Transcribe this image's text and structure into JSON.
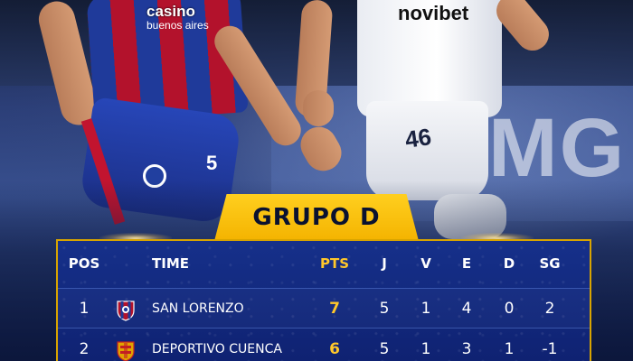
{
  "photo": {
    "left_player_sponsor_line1": "casino",
    "left_player_sponsor_line2": "buenos aires",
    "left_player_number": "5",
    "right_player_sponsor": "novibet",
    "right_player_number": "46",
    "background_board_text": "MG"
  },
  "banner": {
    "title": "GRUPO D"
  },
  "table": {
    "headers": {
      "pos": "POS",
      "team": "TIME",
      "pts": "PTS",
      "j": "J",
      "v": "V",
      "e": "E",
      "d": "D",
      "sg": "SG"
    },
    "rows": [
      {
        "pos": "1",
        "team": "SAN LORENZO",
        "crest": "san-lorenzo-crest",
        "pts": "7",
        "j": "5",
        "v": "1",
        "e": "4",
        "d": "0",
        "sg": "2"
      },
      {
        "pos": "2",
        "team": "DEPORTIVO CUENCA",
        "crest": "deportivo-cuenca-crest",
        "pts": "6",
        "j": "5",
        "v": "1",
        "e": "3",
        "d": "1",
        "sg": "-1"
      }
    ]
  },
  "colors": {
    "banner_yellow": "#ffc400",
    "points_yellow": "#ffc72a",
    "table_blue": "#13298a",
    "table_border": "#d8a400"
  }
}
